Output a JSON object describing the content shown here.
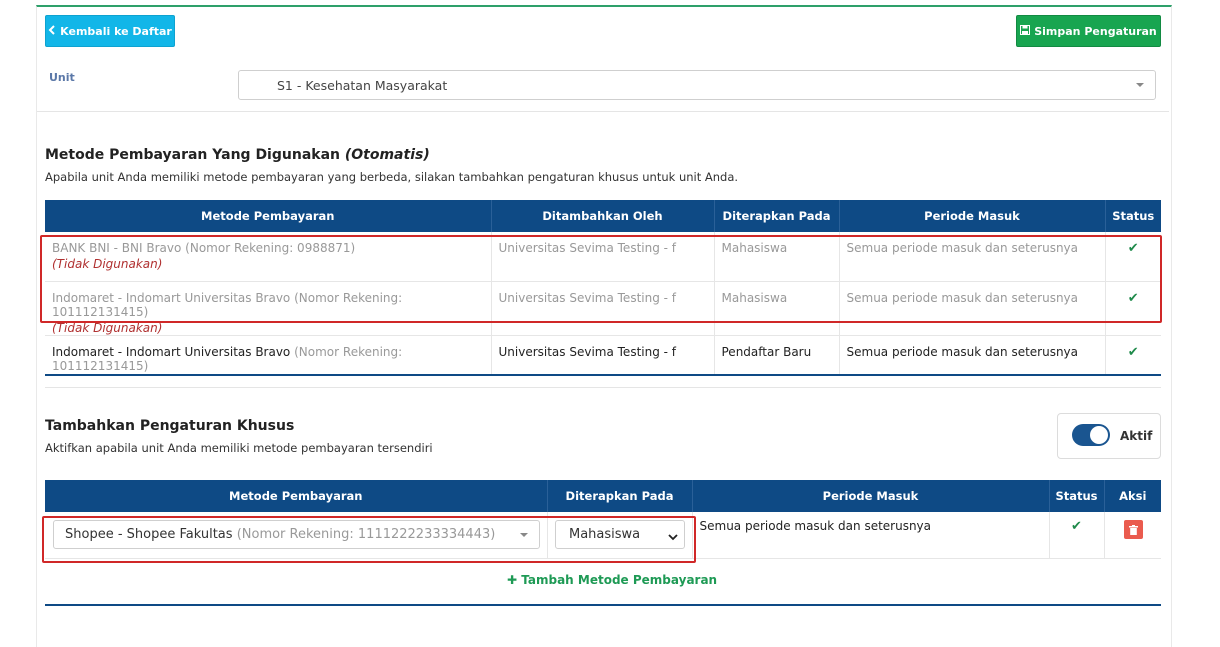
{
  "header": {
    "back_label": "Kembali ke Daftar",
    "save_label": "Simpan Pengaturan"
  },
  "unit": {
    "label": "Unit",
    "value": "S1 - Kesehatan Masyarakat"
  },
  "auto_section": {
    "title": "Metode Pembayaran Yang Digunakan",
    "title_em": "(Otomatis)",
    "desc": "Apabila unit Anda memiliki metode pembayaran yang berbeda, silakan tambahkan pengaturan khusus untuk unit Anda.",
    "columns": [
      "Metode Pembayaran",
      "Ditambahkan Oleh",
      "Diterapkan Pada",
      "Periode Masuk",
      "Status"
    ],
    "rows": [
      {
        "method": "BANK BNI - BNI Bravo",
        "account": "(Nomor Rekening: 0988871)",
        "note": "(Tidak Digunakan)",
        "added_by": "Universitas Sevima Testing - f",
        "applied_to": "Mahasiswa",
        "period": "Semua periode masuk dan seterusnya"
      },
      {
        "method": "Indomaret - Indomart Universitas Bravo",
        "account": "(Nomor Rekening: 101112131415)",
        "note": "(Tidak Digunakan)",
        "added_by": "Universitas Sevima Testing - f",
        "applied_to": "Mahasiswa",
        "period": "Semua periode masuk dan seterusnya"
      },
      {
        "method": "Indomaret - Indomart Universitas Bravo",
        "account": "(Nomor Rekening: 101112131415)",
        "note": "",
        "added_by": "Universitas Sevima Testing - f",
        "applied_to": "Pendaftar Baru",
        "period": "Semua periode masuk dan seterusnya"
      }
    ]
  },
  "custom_section": {
    "title": "Tambahkan Pengaturan Khusus",
    "desc": "Aktifkan apabila unit Anda memiliki metode pembayaran tersendiri",
    "toggle_label": "Aktif",
    "columns": [
      "Metode Pembayaran",
      "Diterapkan Pada",
      "Periode Masuk",
      "Status",
      "Aksi"
    ],
    "row": {
      "method": "Shopee - Shopee Fakultas",
      "account": "(Nomor Rekening: 1111222233334443)",
      "applied_to": "Mahasiswa",
      "period": "Semua periode masuk dan seterusnya"
    },
    "add_label": "Tambah Metode Pembayaran"
  },
  "colors": {
    "header_blue": "#0e4a85",
    "back_btn": "#12b6e8",
    "save_btn": "#18a550",
    "highlight_red": "#d02828"
  },
  "icons": [
    "chevron-left-icon",
    "save-icon",
    "check-icon",
    "plus-icon",
    "trash-icon",
    "chevron-down-icon"
  ]
}
